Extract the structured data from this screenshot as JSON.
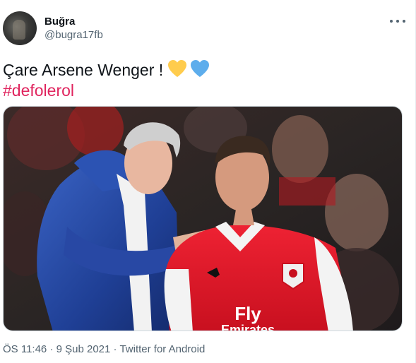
{
  "user": {
    "name": "Buğra",
    "handle": "@bugra17fb"
  },
  "tweet": {
    "text": "Çare Arsene Wenger !",
    "emojis": [
      "yellow-heart-icon",
      "blue-heart-icon"
    ],
    "hashtag": "#defolerol"
  },
  "media": {
    "jersey_sponsor": "Fly Emirates"
  },
  "meta": {
    "time": "ÖS 11:46",
    "separator": "·",
    "date": "9 Şub 2021",
    "source": "Twitter for Android"
  },
  "colors": {
    "hashtag": "#e0245e",
    "secondary_text": "#536471",
    "yellow_heart": "#ffcc4d",
    "blue_heart": "#5dadec"
  }
}
